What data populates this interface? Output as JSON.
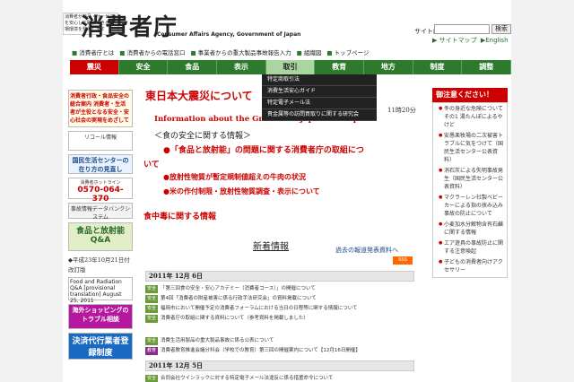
{
  "header": {
    "tagline": "消費者が商品・サービスを安心して取引できる市場環境を整備します",
    "logo": "消費者庁",
    "logo_sub": "Consumer Affairs Agency, Government of Japan",
    "search_label": "サイト内検索",
    "search_button": "検索",
    "util_links": [
      "▶ サイトマップ",
      "▶English"
    ]
  },
  "quicklinks": [
    "消費者庁とは",
    "消費者からの電話窓口",
    "事業者からの重大製品事故報告入力",
    "組織図",
    "トップページ"
  ],
  "nav": [
    "震災",
    "安全",
    "食品",
    "表示",
    "取引",
    "教育",
    "地方",
    "制度",
    "調整"
  ],
  "dropdown": [
    "特定商取引法",
    "消費生活安心ガイド",
    "特定電子メール法",
    "貴金属等の訪問買取りに関する研究会"
  ],
  "left": {
    "banner1": "消費者行政・食品安全の総合案内 消費者・生活者が主役となる安全・安心社会の実現をめざして",
    "banner2": "リコール情報",
    "banner3": "国民生活センターの在り方の見直し",
    "banner4": "0570-064-370",
    "banner4_sub": "消費者ホットライン",
    "banner5": "事故情報データバンクシステム",
    "banner6": "食品と放射能 Q&A",
    "date": "◆平成23年10月21日付",
    "archive": "改訂版",
    "banner7": "Food and Radiation Q&A [provisional translation] August 25, 2011",
    "banner8": "海外ショッピングのトラブル相談",
    "banner9": "決済代行業者登録制度"
  },
  "main": {
    "title": "東日本大震災について",
    "time": "11時20分",
    "english": "Information about the Great East Japan Earthquake",
    "food_heading": "＜食の安全に関する情報＞",
    "food_bullet1": "●「食品と放射能」の問題に関する消費者庁の取組につ",
    "food_bullet1_wrap": "いて",
    "food_bullet2": "●放射性物質が暫定規制値超えの牛肉の状況",
    "food_bullet3": "●米の作付制限・放射性物質調査・表示について",
    "poison": "食中毒に関する情報",
    "news_heading": "新着情報",
    "news_archive": "過去の報道発表資料へ",
    "rss": "RSS",
    "date1": "2011年 12月 6日",
    "news1": [
      {
        "tag": "安全",
        "text": "「第三回食の安全・安心アカデミー（消費者コース）」の開催について"
      },
      {
        "tag": "安全",
        "text": "第4回「消費者の財産被害に係る行政手法研究会」の資料掲載について"
      },
      {
        "tag": "安全",
        "text": "福岡市において開催予定の消費者フォーラムにおける当日の日程等に関する情報について"
      },
      {
        "tag": "安全",
        "text": "消費者庁の取組に関する資料について（参考資料を掲載しました）"
      },
      {
        "tag": "安全",
        "text": "消費生活用製品の重大製品事故に係る公表について"
      },
      {
        "tag": "教育",
        "text": "消費者教育推進会議分科会（学校での教育）第三回の開催案内について【12月16日開催】"
      }
    ],
    "date2": "2011年 12月 5日",
    "news2": [
      {
        "tag": "安全",
        "text": "合同会社ウインラックに対する特定電子メール法違反に係る措置命令について"
      }
    ]
  },
  "right": {
    "heading": "御注意ください！",
    "alerts": [
      "冬の身近な危険について その1 湯たんぽによるやけど",
      "安愚楽牧場の二次被害トラブルに気をつけて（国民生活センター公表資料）",
      "消石灰による失明事故発生（国民生活センター公表資料）",
      "マクラーレン社製ベビーカーによる指の挟み込み事故の防止について",
      "小麦加水分解物含有石鹸に関する情報",
      "エア遊具の事故防止に関する注意喚起",
      "子どもの消費者向けアクセサリー"
    ]
  }
}
